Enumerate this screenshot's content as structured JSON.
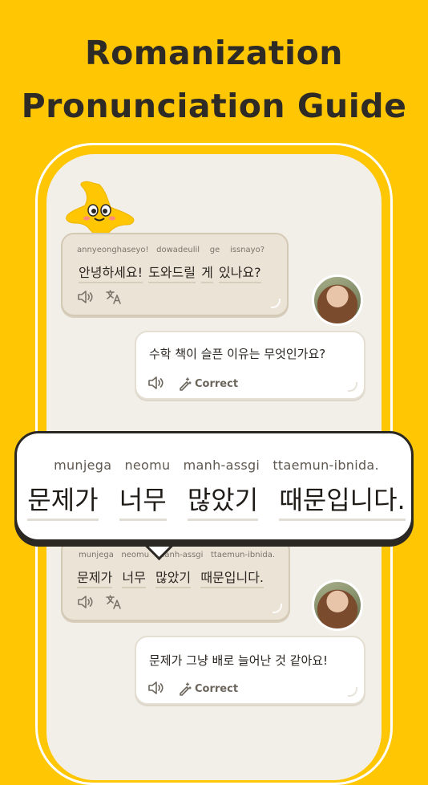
{
  "header": {
    "line1": "Romanization",
    "line2": "Pronunciation Guide"
  },
  "chat": {
    "msg1": {
      "romanization": [
        "annyeonghaseyo!",
        "dowadeulil",
        "ge",
        "issnayo?"
      ],
      "hangul": [
        "안녕하세요!",
        "도와드릴",
        "게",
        "있나요?"
      ]
    },
    "msg2": {
      "text": "수학 책이 슬픈 이유는 무엇인가요?",
      "correct_label": "Correct"
    },
    "msg3": {
      "romanization": [
        "munjega",
        "neomu",
        "manh-assgi",
        "ttaemun-ibnida."
      ],
      "hangul": [
        "문제가",
        "너무",
        "많았기",
        "때문입니다."
      ]
    },
    "msg4": {
      "text": "문제가 그냥 배로 늘어난 것 같아요!",
      "correct_label": "Correct"
    }
  },
  "popup": {
    "romanization": [
      "munjega",
      "neomu",
      "manh-assgi",
      "ttaemun-ibnida."
    ],
    "hangul": [
      "문제가",
      "너무",
      "많았기",
      "때문입니다."
    ]
  },
  "colors": {
    "background": "#FFC604",
    "screen": "#F2EFE9",
    "bot_bubble": "#EBE4D6",
    "user_bubble": "#FFFFFF"
  },
  "icons": [
    "speaker-icon",
    "translate-icon",
    "magic-pen-icon",
    "mascot-star-icon",
    "user-avatar"
  ]
}
